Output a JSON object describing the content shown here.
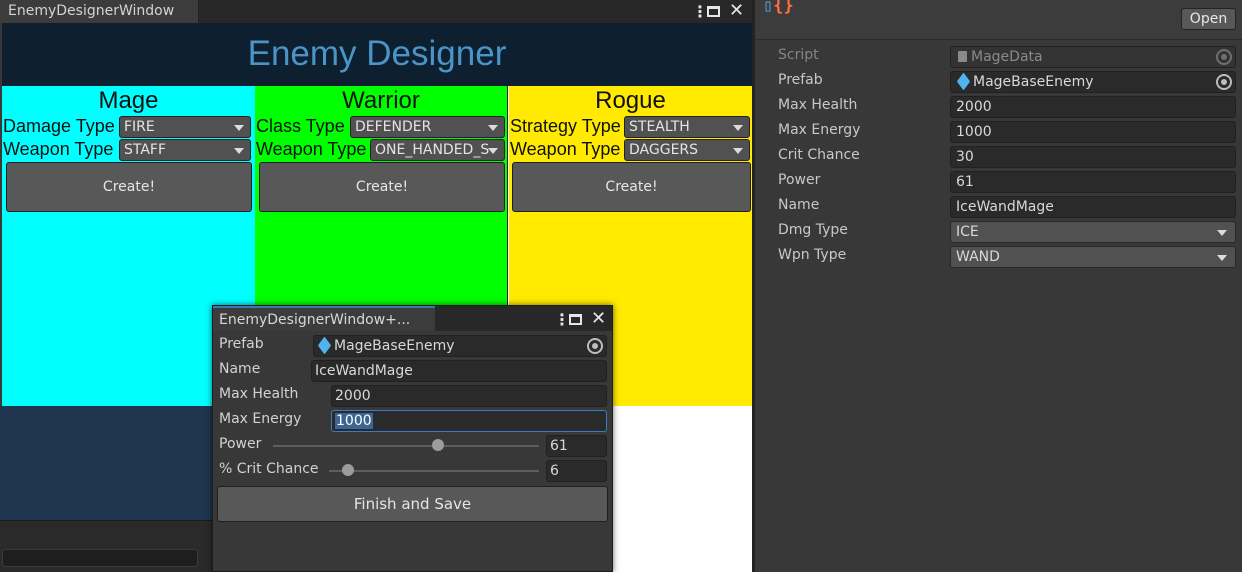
{
  "main_window": {
    "tab_title": "EnemyDesignerWindow",
    "header_title": "Enemy Designer",
    "colors": {
      "header_bg": "#0e1f2f",
      "title": "#4a94c8",
      "mage": "#00ffff",
      "warrior": "#00ff00",
      "rogue": "#ffea00"
    },
    "columns": {
      "mage": {
        "title": "Mage",
        "fields": [
          {
            "label": "Damage Type",
            "value": "FIRE"
          },
          {
            "label": "Weapon Type",
            "value": "STAFF"
          }
        ],
        "button": "Create!"
      },
      "warrior": {
        "title": "Warrior",
        "fields": [
          {
            "label": "Class Type",
            "value": "DEFENDER"
          },
          {
            "label": "Weapon Type",
            "value": "ONE_HANDED_S"
          }
        ],
        "button": "Create!"
      },
      "rogue": {
        "title": "Rogue",
        "fields": [
          {
            "label": "Strategy Type",
            "value": "STEALTH"
          },
          {
            "label": "Weapon Type",
            "value": "DAGGERS"
          }
        ],
        "button": "Create!"
      }
    }
  },
  "popup": {
    "tab_title": "EnemyDesignerWindow+...",
    "prefab": {
      "label": "Prefab",
      "value": "MageBaseEnemy"
    },
    "name": {
      "label": "Name",
      "value": "IceWandMage"
    },
    "max_health": {
      "label": "Max Health",
      "value": "2000"
    },
    "max_energy": {
      "label": "Max Energy",
      "value": "1000"
    },
    "power": {
      "label": "Power",
      "value": "61",
      "slider_fraction": 0.62
    },
    "crit_chance": {
      "label": "% Crit Chance",
      "value": "6",
      "slider_fraction": 0.06
    },
    "finish_button": "Finish and Save"
  },
  "inspector": {
    "open_button": "Open",
    "rows": {
      "script": {
        "label": "Script",
        "value": "MageData"
      },
      "prefab": {
        "label": "Prefab",
        "value": "MageBaseEnemy"
      },
      "max_health": {
        "label": "Max Health",
        "value": "2000"
      },
      "max_energy": {
        "label": "Max Energy",
        "value": "1000"
      },
      "crit_chance": {
        "label": "Crit Chance",
        "value": "30"
      },
      "power": {
        "label": "Power",
        "value": "61"
      },
      "name": {
        "label": "Name",
        "value": "IceWandMage"
      },
      "dmg_type": {
        "label": "Dmg Type",
        "value": "ICE"
      },
      "wpn_type": {
        "label": "Wpn Type",
        "value": "WAND"
      }
    }
  }
}
